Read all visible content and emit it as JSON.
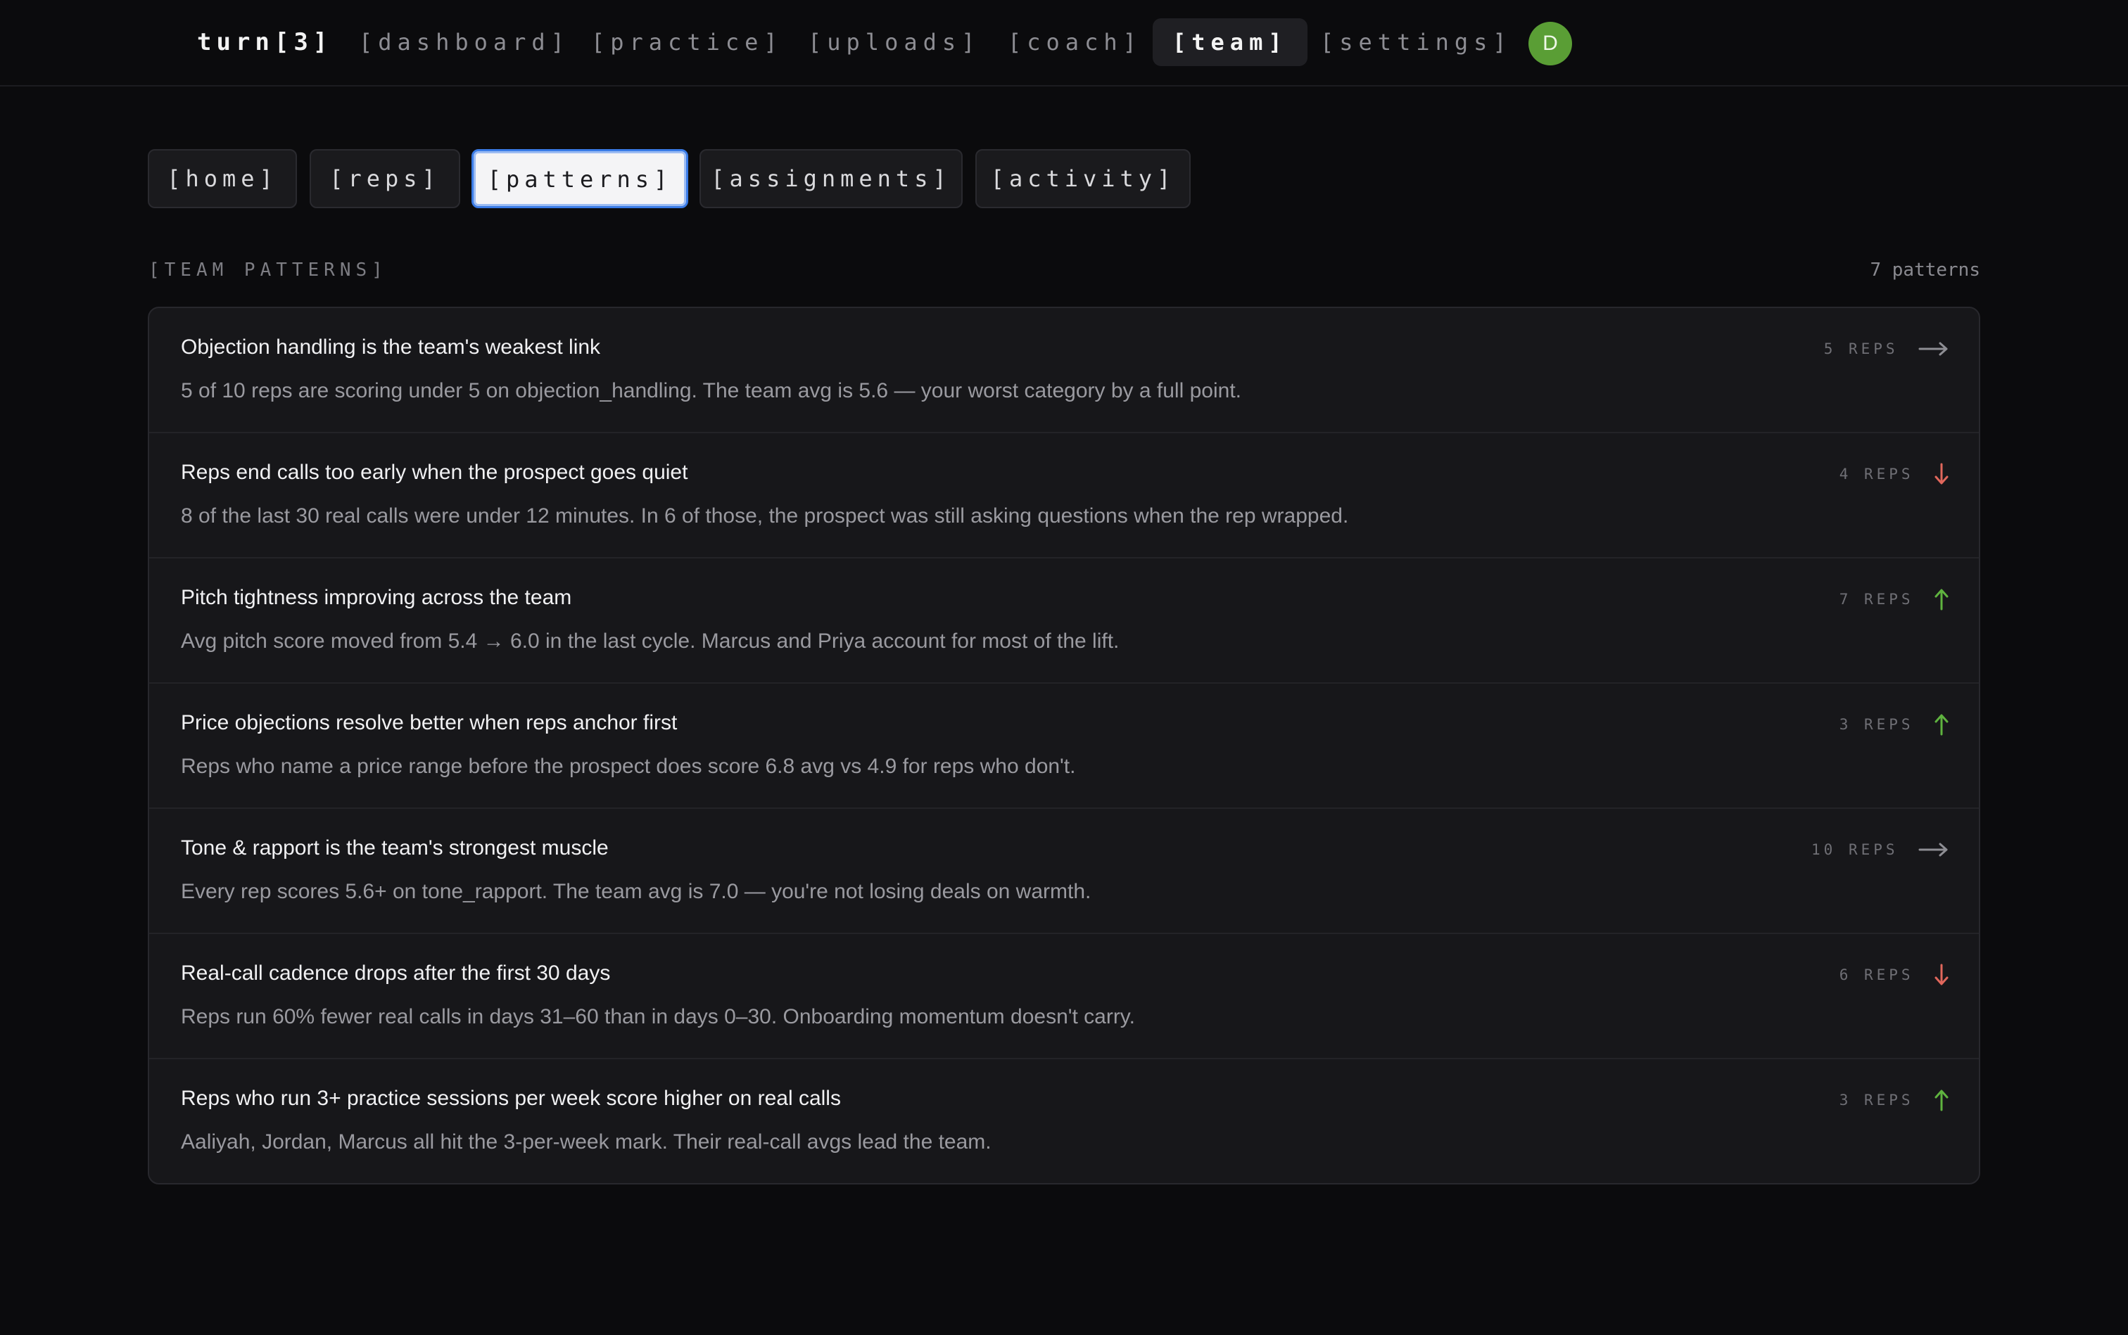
{
  "app": {
    "brand": "turn[3]"
  },
  "nav": {
    "items": [
      {
        "label": "[dashboard]",
        "active": false
      },
      {
        "label": "[practice]",
        "active": false
      },
      {
        "label": "[uploads]",
        "active": false
      },
      {
        "label": "[coach]",
        "active": false
      },
      {
        "label": "[team]",
        "active": true
      },
      {
        "label": "[settings]",
        "active": false
      }
    ],
    "avatar_initial": "D"
  },
  "subtabs": [
    {
      "label": "[home]",
      "active": false
    },
    {
      "label": "[reps]",
      "active": false
    },
    {
      "label": "[patterns]",
      "active": true
    },
    {
      "label": "[assignments]",
      "active": false
    },
    {
      "label": "[activity]",
      "active": false
    }
  ],
  "section": {
    "title": "[TEAM PATTERNS]",
    "count": "7 patterns"
  },
  "colors": {
    "trend_flat": "#8e8e94",
    "trend_down": "#e0675c",
    "trend_up": "#5fb33f",
    "active_tab_border": "#3a7be6",
    "avatar": "#5a9e35"
  },
  "patterns": [
    {
      "title": "Objection handling is the team's weakest link",
      "description": "5 of 10 reps are scoring under 5 on objection_handling. The team avg is 5.6 — your worst category by a full point.",
      "reps": "5 REPS",
      "trend": "flat",
      "trend_icon": "arrow-right-icon"
    },
    {
      "title": "Reps end calls too early when the prospect goes quiet",
      "description": "8 of the last 30 real calls were under 12 minutes. In 6 of those, the prospect was still asking questions when the rep wrapped.",
      "reps": "4 REPS",
      "trend": "down",
      "trend_icon": "arrow-down-icon"
    },
    {
      "title": "Pitch tightness improving across the team",
      "description": "Avg pitch score moved from 5.4 → 6.0 in the last cycle. Marcus and Priya account for most of the lift.",
      "reps": "7 REPS",
      "trend": "up",
      "trend_icon": "arrow-up-icon"
    },
    {
      "title": "Price objections resolve better when reps anchor first",
      "description": "Reps who name a price range before the prospect does score 6.8 avg vs 4.9 for reps who don't.",
      "reps": "3 REPS",
      "trend": "up",
      "trend_icon": "arrow-up-icon"
    },
    {
      "title": "Tone & rapport is the team's strongest muscle",
      "description": "Every rep scores 5.6+ on tone_rapport. The team avg is 7.0 — you're not losing deals on warmth.",
      "reps": "10 REPS",
      "trend": "flat",
      "trend_icon": "arrow-right-icon"
    },
    {
      "title": "Real-call cadence drops after the first 30 days",
      "description": "Reps run 60% fewer real calls in days 31–60 than in days 0–30. Onboarding momentum doesn't carry.",
      "reps": "6 REPS",
      "trend": "down",
      "trend_icon": "arrow-down-icon"
    },
    {
      "title": "Reps who run 3+ practice sessions per week score higher on real calls",
      "description": "Aaliyah, Jordan, Marcus all hit the 3-per-week mark. Their real-call avgs lead the team.",
      "reps": "3 REPS",
      "trend": "up",
      "trend_icon": "arrow-up-icon"
    }
  ]
}
